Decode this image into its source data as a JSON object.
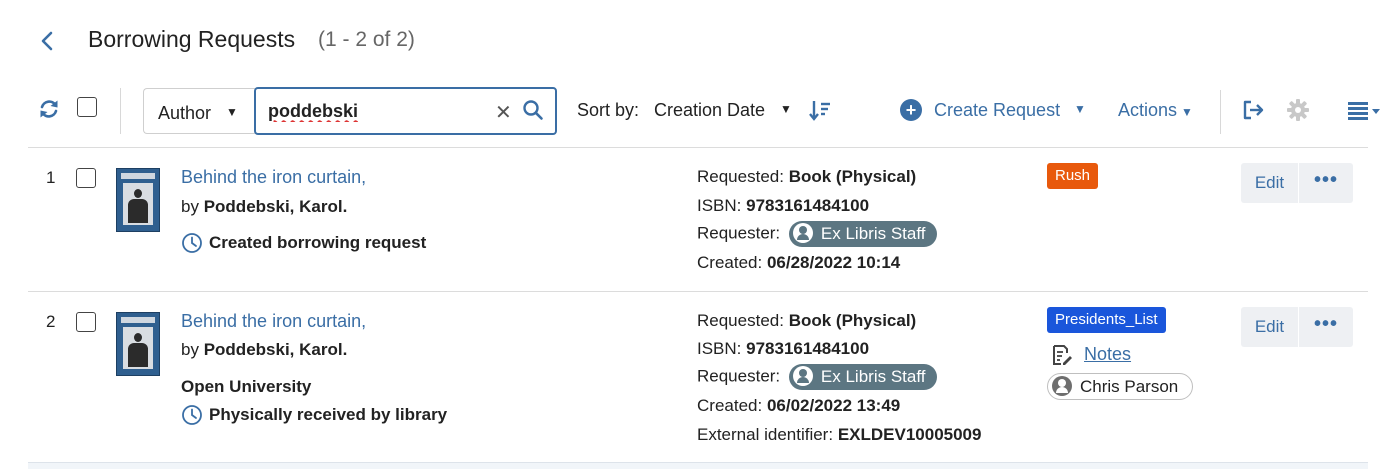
{
  "header": {
    "title": "Borrowing Requests",
    "count": "(1 - 2 of 2)"
  },
  "toolbar": {
    "filter_field": "Author",
    "search_value": "poddebski",
    "sort_label": "Sort by:",
    "sort_value": "Creation Date",
    "create_label": "Create Request",
    "actions_label": "Actions"
  },
  "icons": {
    "back": "chevron-left-icon",
    "refresh": "refresh-icon",
    "search": "search-icon",
    "clear": "clear-icon",
    "sort_direction": "sort-descending-icon",
    "create": "plus-circle-icon",
    "export": "export-icon",
    "settings": "gear-icon",
    "view": "list-view-icon",
    "clock": "clock-icon",
    "notes": "notes-icon",
    "person": "person-icon"
  },
  "colors": {
    "link": "#3a6ea5",
    "rush": "#e8590c",
    "presidents_list": "#1a56db",
    "requester_chip": "#5c7682"
  },
  "rows": [
    {
      "index": "1",
      "title": "Behind the iron curtain,",
      "by_prefix": "by",
      "author": "Poddebski, Karol.",
      "partner": "",
      "status": "Created borrowing request",
      "requested_label": "Requested:",
      "requested_value": "Book (Physical)",
      "isbn_label": "ISBN:",
      "isbn_value": "9783161484100",
      "requester_label": "Requester:",
      "requester_value": "Ex Libris Staff",
      "created_label": "Created:",
      "created_value": "06/28/2022 10:14",
      "tag": "Rush",
      "edit_label": "Edit",
      "more_label": "•••"
    },
    {
      "index": "2",
      "title": "Behind the iron curtain,",
      "by_prefix": "by",
      "author": "Poddebski, Karol.",
      "partner": "Open University",
      "status": "Physically received by library",
      "requested_label": "Requested:",
      "requested_value": "Book (Physical)",
      "isbn_label": "ISBN:",
      "isbn_value": "9783161484100",
      "requester_label": "Requester:",
      "requester_value": "Ex Libris Staff",
      "created_label": "Created:",
      "created_value": "06/02/2022 13:49",
      "external_label": "External identifier:",
      "external_value": "EXLDEV10005009",
      "tag": "Presidents_List",
      "notes_label": "Notes",
      "assignee": "Chris Parson",
      "edit_label": "Edit",
      "more_label": "•••"
    }
  ]
}
